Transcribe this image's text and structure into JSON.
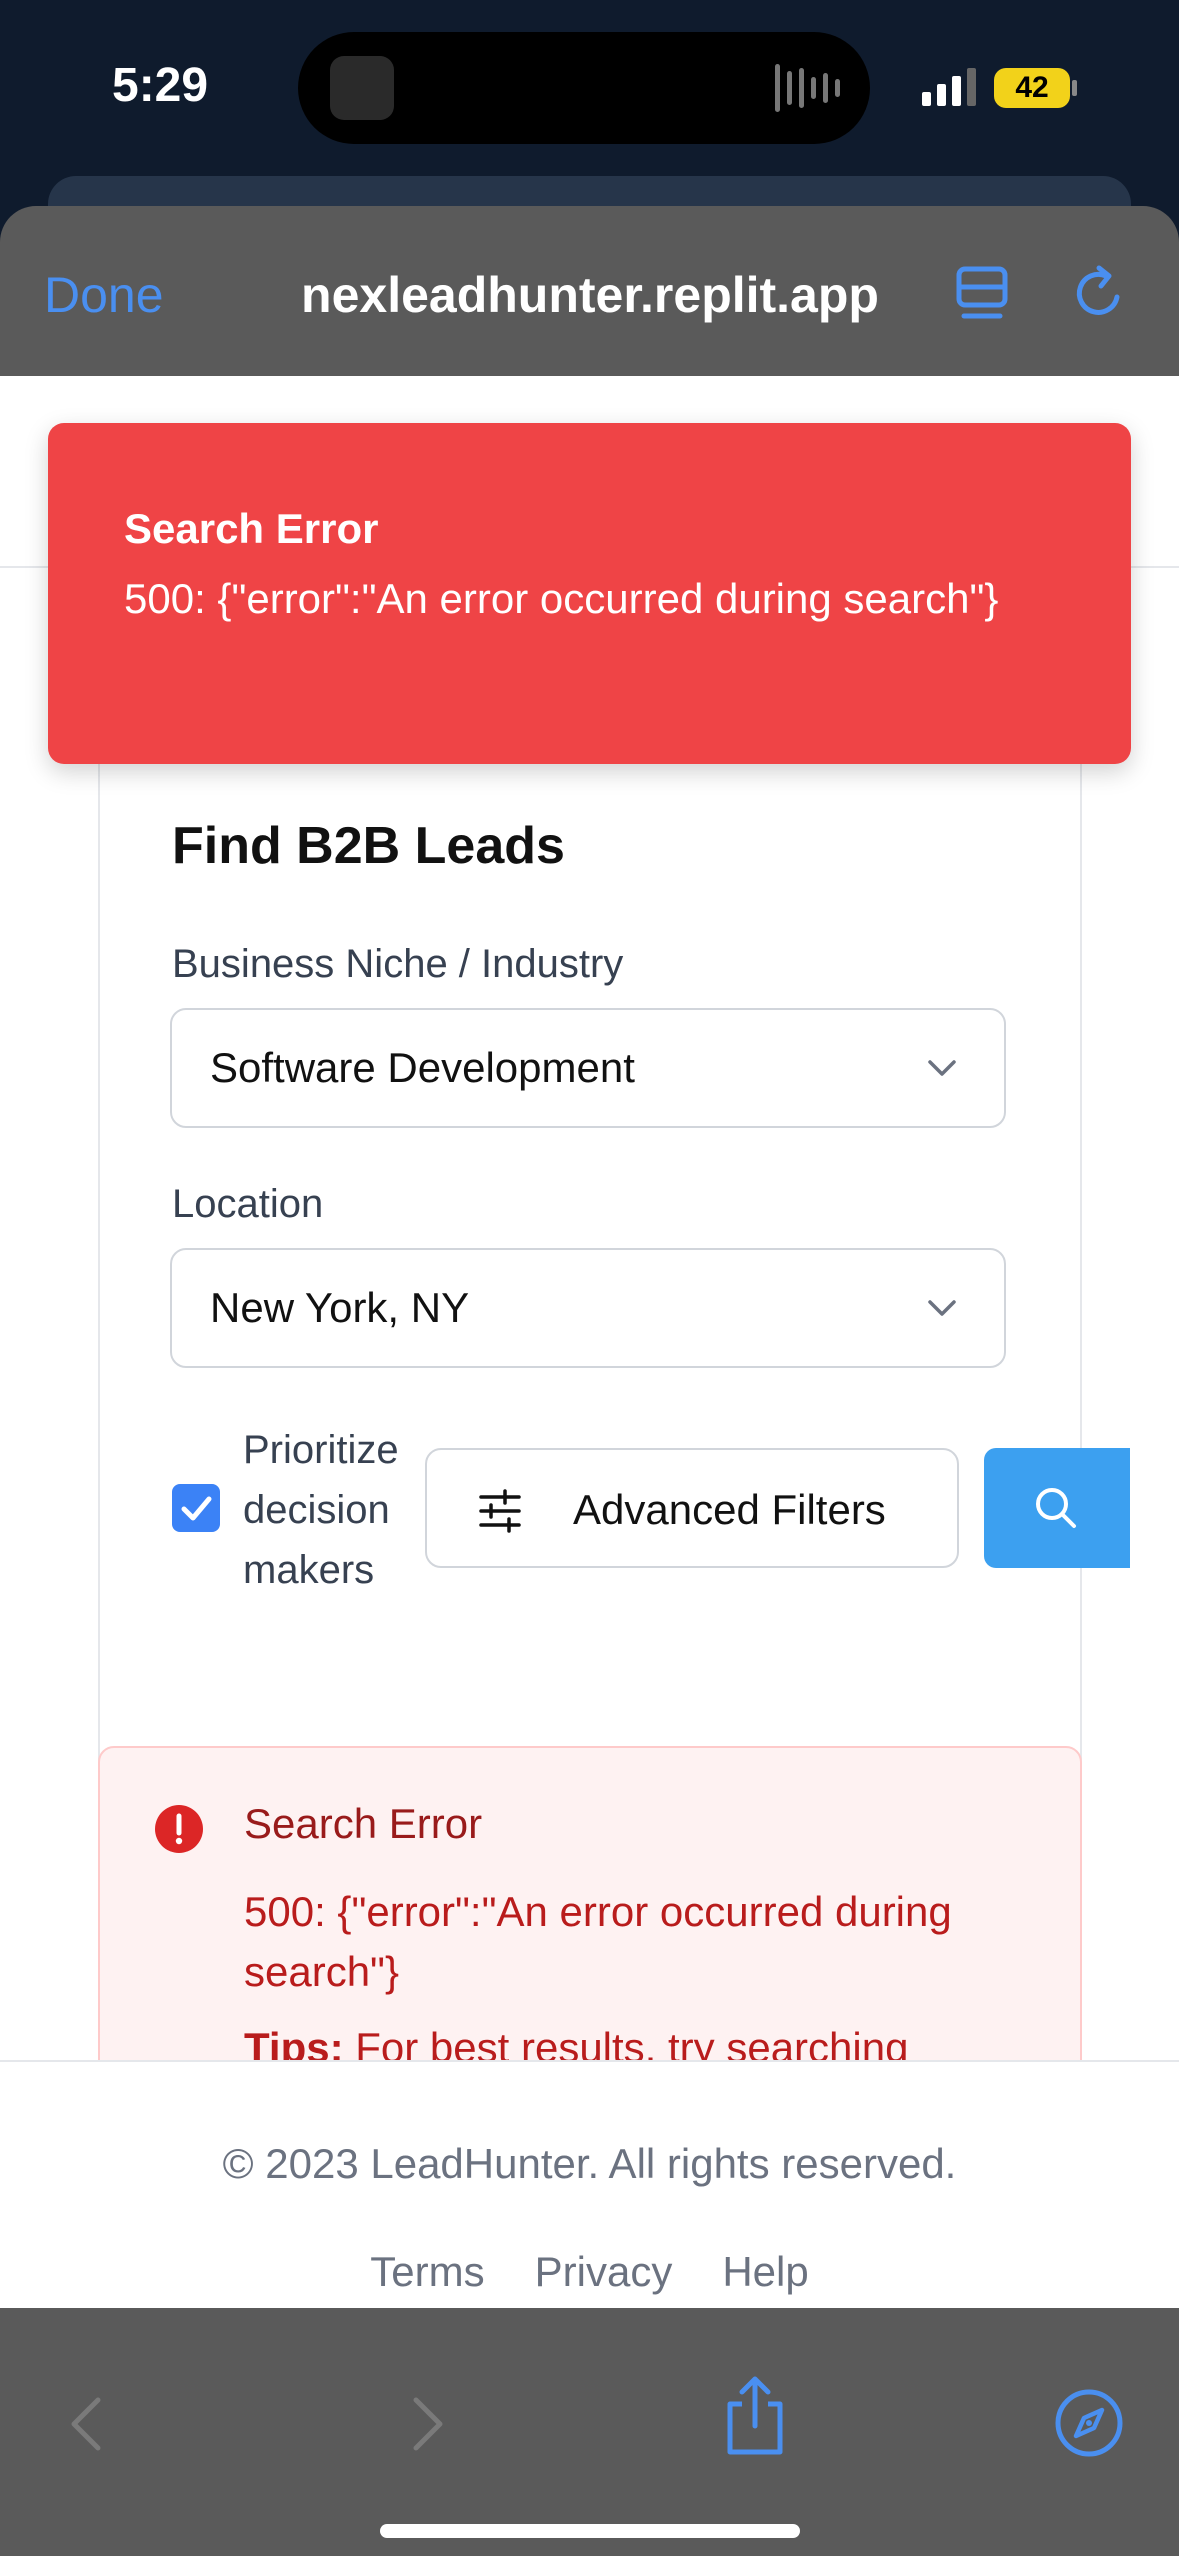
{
  "status_bar": {
    "time": "5:29",
    "battery": "42"
  },
  "browser": {
    "done_label": "Done",
    "url": "nexleadhunter.replit.app"
  },
  "toast": {
    "title": "Search Error",
    "message": "500: {\"error\":\"An error occurred during search\"}"
  },
  "search_form": {
    "title": "Find B2B Leads",
    "niche_label": "Business Niche / Industry",
    "niche_value": "Software Development",
    "location_label": "Location",
    "location_value": "New York, NY",
    "prioritize_label": "Prioritize decision makers",
    "prioritize_checked": true,
    "advanced_filters_label": "Advanced Filters"
  },
  "error_box": {
    "title": "Search Error",
    "message": "500: {\"error\":\"An error occurred during search\"}",
    "tips_label": "Tips:",
    "tips_text": "For best results, try searching"
  },
  "footer": {
    "copyright": "© 2023 LeadHunter. All rights reserved.",
    "links": [
      "Terms",
      "Privacy",
      "Help"
    ]
  },
  "colors": {
    "accent": "#3b82f6",
    "error": "#ef4446",
    "toolbar": "#5a5a5a"
  },
  "icons": [
    "reader-icon",
    "reload-icon",
    "chevron-down-icon",
    "sliders-icon",
    "search-icon",
    "alert-circle-icon",
    "back-icon",
    "forward-icon",
    "share-icon",
    "compass-icon"
  ]
}
